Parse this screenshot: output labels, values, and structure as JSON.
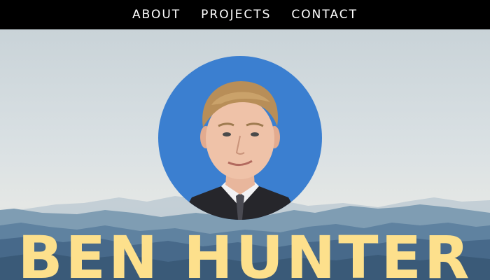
{
  "nav": {
    "items": [
      {
        "label": "ABOUT"
      },
      {
        "label": "PROJECTS"
      },
      {
        "label": "CONTACT"
      }
    ]
  },
  "hero": {
    "name": "BEN HUNTER",
    "name_color": "#fde08c",
    "avatar_bg_color": "#3b7fd0"
  }
}
